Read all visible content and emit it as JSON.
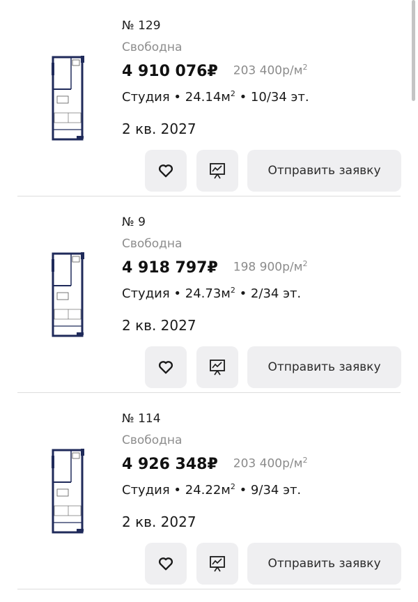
{
  "listings": [
    {
      "number": "№ 129",
      "status": "Свободна",
      "price": "4 910 076₽",
      "price_per_m2": "203 400р/м",
      "price_per_m2_unit_exp": "2",
      "type": "Студия",
      "area": "24.14м",
      "area_exp": "2",
      "floor": "10/34 эт.",
      "delivery": "2 кв. 2027",
      "favorite_icon": "heart-icon",
      "chart_icon": "presentation-chart-icon",
      "apply_label": "Отправить заявку"
    },
    {
      "number": "№ 9",
      "status": "Свободна",
      "price": "4 918 797₽",
      "price_per_m2": "198 900р/м",
      "price_per_m2_unit_exp": "2",
      "type": "Студия",
      "area": "24.73м",
      "area_exp": "2",
      "floor": "2/34 эт.",
      "delivery": "2 кв. 2027",
      "favorite_icon": "heart-icon",
      "chart_icon": "presentation-chart-icon",
      "apply_label": "Отправить заявку"
    },
    {
      "number": "№ 114",
      "status": "Свободна",
      "price": "4 926 348₽",
      "price_per_m2": "203 400р/м",
      "price_per_m2_unit_exp": "2",
      "type": "Студия",
      "area": "24.22м",
      "area_exp": "2",
      "floor": "9/34 эт.",
      "delivery": "2 кв. 2027",
      "favorite_icon": "heart-icon",
      "chart_icon": "presentation-chart-icon",
      "apply_label": "Отправить заявку"
    }
  ],
  "separator": " • ",
  "colors": {
    "plan_wall": "#1f2a5a",
    "button_bg": "#efeff1",
    "muted_text": "#8d8d8d"
  }
}
